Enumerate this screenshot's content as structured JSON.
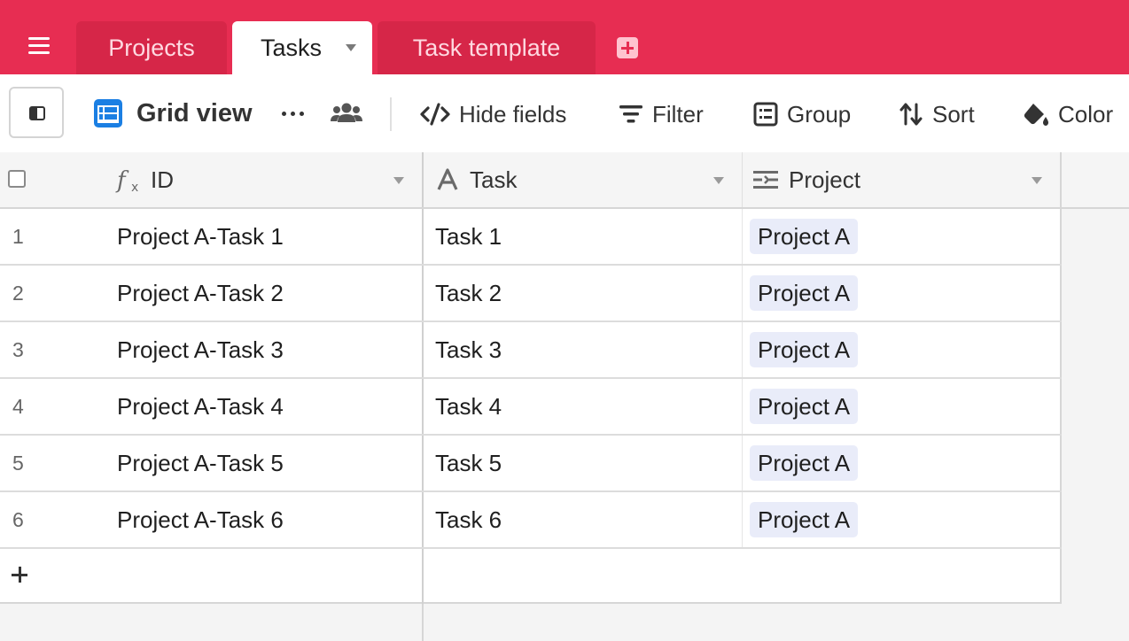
{
  "tabs": [
    {
      "label": "Projects",
      "active": false
    },
    {
      "label": "Tasks",
      "active": true
    },
    {
      "label": "Task template",
      "active": false
    }
  ],
  "toolbar": {
    "view_name": "Grid view",
    "hide_fields": "Hide fields",
    "filter": "Filter",
    "group": "Group",
    "sort": "Sort",
    "color": "Color"
  },
  "columns": {
    "id": "ID",
    "task": "Task",
    "project": "Project"
  },
  "rows": [
    {
      "num": "1",
      "id": "Project A-Task 1",
      "task": "Task 1",
      "project": "Project A"
    },
    {
      "num": "2",
      "id": "Project A-Task 2",
      "task": "Task 2",
      "project": "Project A"
    },
    {
      "num": "3",
      "id": "Project A-Task 3",
      "task": "Task 3",
      "project": "Project A"
    },
    {
      "num": "4",
      "id": "Project A-Task 4",
      "task": "Task 4",
      "project": "Project A"
    },
    {
      "num": "5",
      "id": "Project A-Task 5",
      "task": "Task 5",
      "project": "Project A"
    },
    {
      "num": "6",
      "id": "Project A-Task 6",
      "task": "Task 6",
      "project": "Project A"
    }
  ],
  "colors": {
    "topbar": "#e72d52",
    "accent_blue": "#1b7fe3",
    "chip_bg": "#e9ecf9"
  },
  "icons": {
    "menu": "hamburger-menu-icon",
    "add_tab": "plus-square-icon",
    "sidebar": "sidebar-toggle-icon",
    "view": "grid-view-icon",
    "more": "ellipsis-icon",
    "collaborators": "people-icon",
    "hide_fields": "eye-slash-code-icon",
    "filter": "filter-lines-icon",
    "group": "group-list-icon",
    "sort": "sort-arrows-icon",
    "color": "paint-bucket-icon",
    "formula_field": "formula-fx-icon",
    "text_field": "text-a-icon",
    "link_field": "linked-record-icon"
  }
}
